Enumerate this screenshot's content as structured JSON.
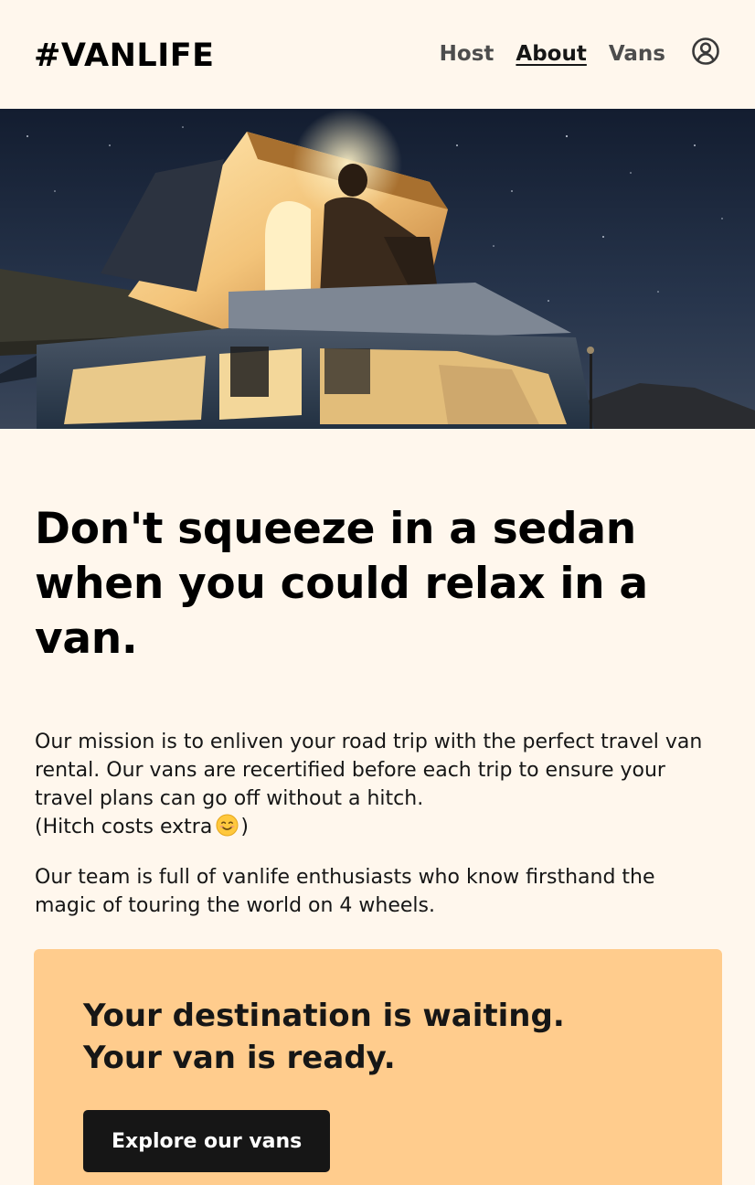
{
  "header": {
    "logo": "#VANLIFE",
    "nav": {
      "host": "Host",
      "about": "About",
      "vans": "Vans"
    },
    "user_icon": "user-circle-icon"
  },
  "hero": {
    "image": "camper-van-night-photo"
  },
  "main": {
    "headline": "Don't squeeze in a sedan when you could relax in a van.",
    "paragraph_1": "Our mission is to enliven your road trip with the perfect travel van rental. Our vans are recertified before each trip to ensure your travel plans can go off without a hitch.",
    "paragraph_1_tail": "(Hitch costs extra",
    "paragraph_1_close": ")",
    "emoji": "smiling-face-emoji",
    "paragraph_2": "Our team is full of vanlife enthusiasts who know firsthand the magic of touring the world on 4 wheels."
  },
  "cta": {
    "line_1": "Your destination is waiting.",
    "line_2": "Your van is ready.",
    "button_label": "Explore our vans"
  },
  "colors": {
    "background": "#FFF7ED",
    "cta_background": "#FFCC8D",
    "button_background": "#161616",
    "text": "#161616"
  }
}
